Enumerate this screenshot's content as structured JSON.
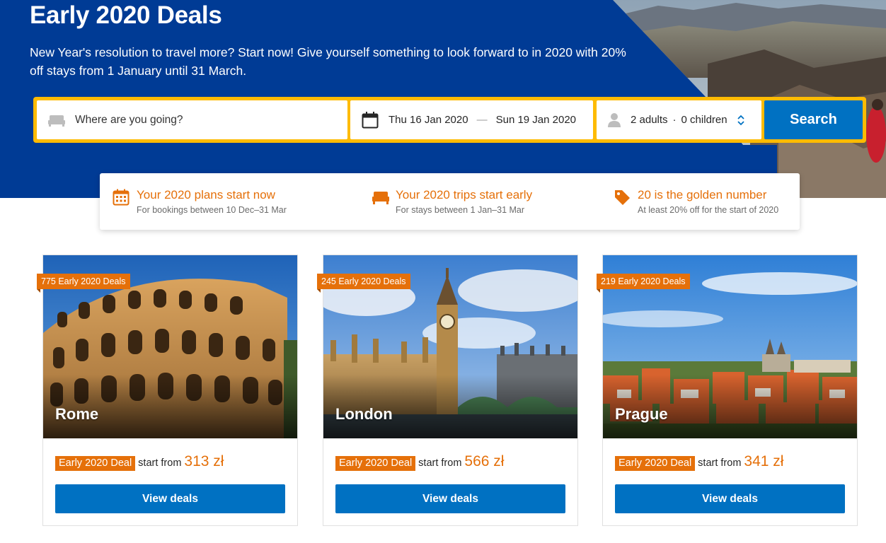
{
  "hero": {
    "title": "Early 2020 Deals",
    "subtitle": "New Year's resolution to travel more? Start now! Give yourself something to look forward to in 2020 with 20% off stays from 1 January until 31 March."
  },
  "search": {
    "destination_placeholder": "Where are you going?",
    "checkin": "Thu 16 Jan 2020",
    "date_separator": "—",
    "checkout": "Sun 19 Jan 2020",
    "adults": "2 adults",
    "guests_separator": "·",
    "children": "0 children",
    "button_label": "Search"
  },
  "info_strip": [
    {
      "icon": "calendar-icon",
      "title": "Your 2020 plans start now",
      "desc": "For bookings between 10 Dec–31 Mar"
    },
    {
      "icon": "bed-icon",
      "title": "Your 2020 trips start early",
      "desc": "For stays between 1 Jan–31 Mar"
    },
    {
      "icon": "tag-icon",
      "title": "20 is the golden number",
      "desc": "At least 20% off for the start of 2020"
    }
  ],
  "cards": [
    {
      "ribbon": "775 Early 2020 Deals",
      "city": "Rome",
      "badge": "Early 2020 Deal",
      "start_from": "start from",
      "price": "313 zł",
      "button": "View deals"
    },
    {
      "ribbon": "245 Early 2020 Deals",
      "city": "London",
      "badge": "Early 2020 Deal",
      "start_from": "start from",
      "price": "566 zł",
      "button": "View deals"
    },
    {
      "ribbon": "219 Early 2020 Deals",
      "city": "Prague",
      "badge": "Early 2020 Deal",
      "start_from": "start from",
      "price": "341 zł",
      "button": "View deals"
    }
  ],
  "colors": {
    "hero_blue": "#003b95",
    "search_yellow": "#febb02",
    "button_blue": "#0071c2",
    "deal_orange": "#e5700a"
  }
}
